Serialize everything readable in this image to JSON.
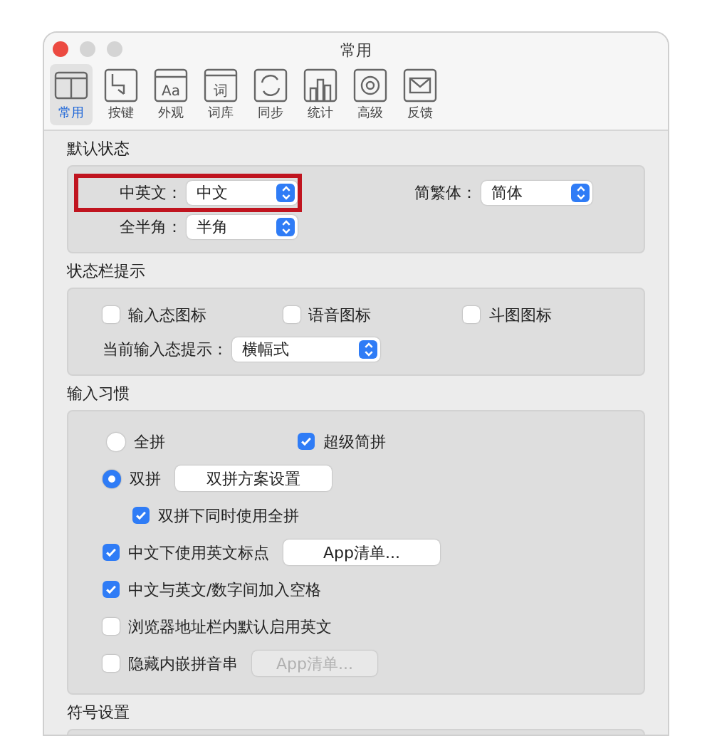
{
  "window": {
    "title": "常用"
  },
  "toolbar": [
    {
      "label": "常用",
      "selected": true
    },
    {
      "label": "按键",
      "selected": false
    },
    {
      "label": "外观",
      "icon_text": "Aa",
      "selected": false
    },
    {
      "label": "词库",
      "icon_text": "词",
      "selected": false
    },
    {
      "label": "同步",
      "selected": false
    },
    {
      "label": "统计",
      "selected": false
    },
    {
      "label": "高级",
      "selected": false
    },
    {
      "label": "反馈",
      "selected": false
    }
  ],
  "sections": [
    {
      "title": "默认状态",
      "rows": [
        [
          {
            "kind": "select",
            "label": "中英文：",
            "value": "中文",
            "highlighted": true
          },
          {
            "kind": "select",
            "label": "简繁体：",
            "value": "简体",
            "highlighted": false
          }
        ],
        [
          {
            "kind": "select",
            "label": "全半角：",
            "value": "半角",
            "highlighted": false
          }
        ]
      ]
    },
    {
      "title": "状态栏提示",
      "rows": [
        [
          {
            "kind": "checkbox",
            "label": "输入态图标",
            "checked": false
          },
          {
            "kind": "checkbox",
            "label": "语音图标",
            "checked": false
          },
          {
            "kind": "checkbox",
            "label": "斗图图标",
            "checked": false
          }
        ],
        [
          {
            "kind": "select",
            "label": "当前输入态提示：",
            "value": "横幅式",
            "highlighted": false
          }
        ]
      ]
    },
    {
      "title": "输入习惯",
      "rows": [
        [
          {
            "kind": "radio",
            "label": "全拼",
            "selected": false
          },
          {
            "kind": "checkbox",
            "label": "超级简拼",
            "checked": true
          }
        ],
        [
          {
            "kind": "radio",
            "label": "双拼",
            "selected": true
          },
          {
            "kind": "button",
            "label": "双拼方案设置",
            "disabled": false
          }
        ],
        {
          "children": [
            [
              {
                "kind": "checkbox",
                "label": "双拼下同时使用全拼",
                "checked": true
              }
            ]
          ]
        },
        [
          {
            "kind": "checkbox",
            "label": "中文下使用英文标点",
            "checked": true
          },
          {
            "kind": "button",
            "label": "App清单...",
            "disabled": false
          }
        ],
        [
          {
            "kind": "checkbox",
            "label": "中文与英文/数字间加入空格",
            "checked": true
          }
        ],
        [
          {
            "kind": "checkbox",
            "label": "浏览器地址栏内默认启用英文",
            "checked": false
          }
        ],
        [
          {
            "kind": "checkbox",
            "label": "隐藏内嵌拼音串",
            "checked": false
          },
          {
            "kind": "button",
            "label": "App清单...",
            "disabled": true
          }
        ]
      ]
    },
    {
      "title": "符号设置"
    }
  ]
}
